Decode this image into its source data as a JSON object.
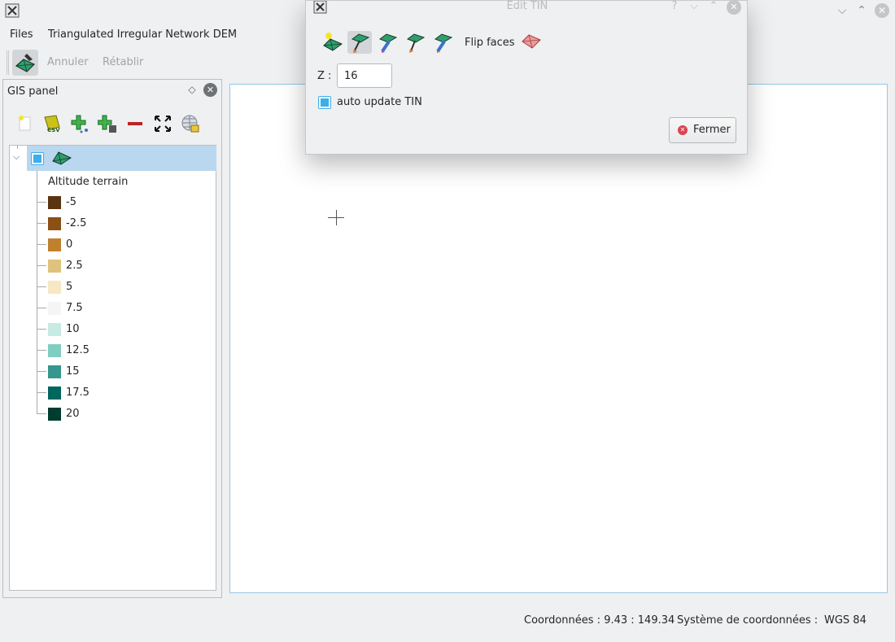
{
  "menu": {
    "files": "Files",
    "tin_dem": "Triangulated Irregular Network DEM"
  },
  "toolbar": {
    "undo": "Annuler",
    "redo": "Rétablir"
  },
  "window_controls": {
    "minimize": "⌵",
    "maximize": "⌃",
    "close": "✕"
  },
  "gis_panel": {
    "title": "GIS panel",
    "float_icon": "◇",
    "close_icon": "✕",
    "tools": [
      "new-layer-icon",
      "import-csv-icon",
      "add-point-layer-icon",
      "add-raster-layer-icon",
      "remove-layer-icon",
      "zoom-extent-icon",
      "web-map-icon"
    ],
    "tree": {
      "legend_title": "Altitude terrain",
      "legend": [
        {
          "label": "-5",
          "color": "#5a3410"
        },
        {
          "label": "-2.5",
          "color": "#8b5013"
        },
        {
          "label": "0",
          "color": "#bf812d"
        },
        {
          "label": "2.5",
          "color": "#dfc27d"
        },
        {
          "label": "5",
          "color": "#f6e8c3"
        },
        {
          "label": "7.5",
          "color": "#f5f5f5"
        },
        {
          "label": "10",
          "color": "#c7eae5"
        },
        {
          "label": "12.5",
          "color": "#80cdc1"
        },
        {
          "label": "15",
          "color": "#35978f"
        },
        {
          "label": "17.5",
          "color": "#01665e"
        },
        {
          "label": "20",
          "color": "#003c30"
        }
      ]
    }
  },
  "status": {
    "coords_label": "Coordonnées : 9.43 : 149.34",
    "crs_label": "Système de coordonnées :",
    "crs_value": "WGS 84"
  },
  "dialog": {
    "title": "Edit TIN",
    "help_icon": "?",
    "tools": [
      "add-vertex-icon",
      "move-vertex-icon",
      "delete-vertex-icon",
      "add-edge-icon",
      "split-edge-icon"
    ],
    "flip_faces": "Flip faces",
    "z_label": "Z :",
    "z_value": "16",
    "auto_update_label": "auto update TIN",
    "auto_update_checked": true,
    "close_button": "Fermer"
  }
}
